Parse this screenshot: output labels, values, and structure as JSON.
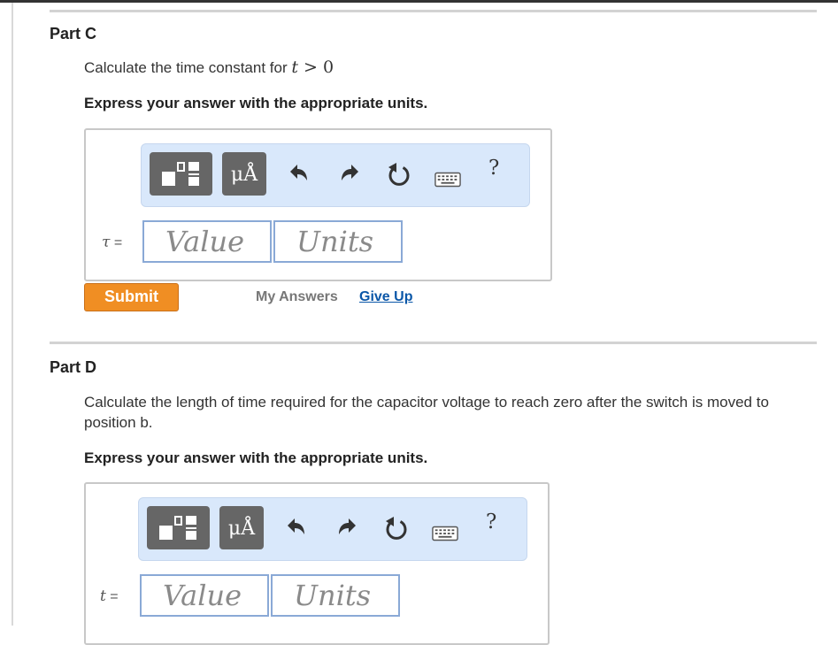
{
  "partC": {
    "title": "Part C",
    "prompt_text": "Calculate the time constant for ",
    "prompt_math_var": "t",
    "prompt_math_op": " > ",
    "prompt_math_num": "0",
    "instruction": "Express your answer with the appropriate units.",
    "toolbar": {
      "symbol_label": "μÅ",
      "help_label": "?"
    },
    "variable": "τ",
    "equals": " =",
    "value_placeholder": "Value",
    "units_placeholder": "Units",
    "submit_label": "Submit",
    "my_answers_label": "My Answers",
    "give_up_label": "Give Up"
  },
  "partD": {
    "title": "Part D",
    "prompt_text": "Calculate the length of time required for the capacitor voltage to reach zero after the switch is moved to position b.",
    "instruction": "Express your answer with the appropriate units.",
    "toolbar": {
      "symbol_label": "μÅ",
      "help_label": "?"
    },
    "variable": "t",
    "equals": " =",
    "value_placeholder": "Value",
    "units_placeholder": "Units"
  },
  "icons": [
    "templates-icon",
    "symbols-icon",
    "undo-icon",
    "redo-icon",
    "reset-icon",
    "keyboard-icon",
    "help-icon"
  ],
  "colors": {
    "submit": "#f08e23",
    "toolbar": "#d9e8fb",
    "field_border": "#8aa9d6",
    "link": "#0b57a8"
  }
}
